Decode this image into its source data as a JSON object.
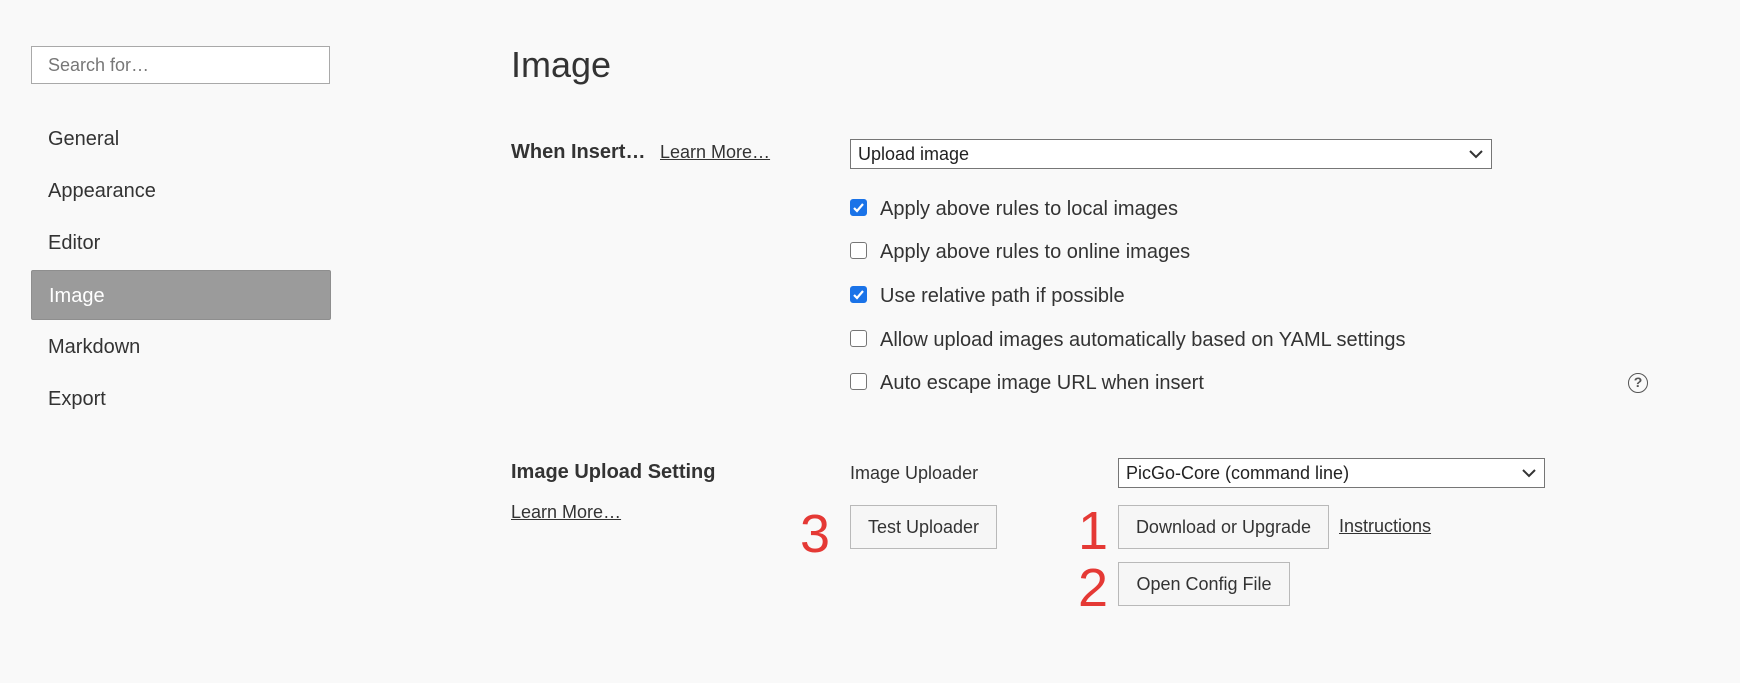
{
  "sidebar": {
    "search_placeholder": "Search for…",
    "items": [
      {
        "label": "General"
      },
      {
        "label": "Appearance"
      },
      {
        "label": "Editor"
      },
      {
        "label": "Image",
        "active": true
      },
      {
        "label": "Markdown"
      },
      {
        "label": "Export"
      }
    ]
  },
  "main": {
    "title": "Image",
    "when_insert": {
      "label": "When Insert…",
      "learn_more": "Learn More…",
      "selected": "Upload image",
      "options": [
        {
          "label": "Apply above rules to local images",
          "checked": true
        },
        {
          "label": "Apply above rules to online images",
          "checked": false
        },
        {
          "label": "Use relative path if possible",
          "checked": true
        },
        {
          "label": "Allow upload images automatically based on YAML settings",
          "checked": false
        },
        {
          "label": "Auto escape image URL when insert",
          "checked": false
        }
      ],
      "help_icon": "?"
    },
    "upload_setting": {
      "label": "Image Upload Setting",
      "learn_more": "Learn More…",
      "uploader_label": "Image Uploader",
      "uploader_selected": "PicGo-Core (command line)",
      "test_button": "Test Uploader",
      "download_button": "Download or Upgrade",
      "instructions_link": "Instructions",
      "open_config_button": "Open Config File"
    },
    "annotations": {
      "one": "1",
      "two": "2",
      "three": "3"
    },
    "colors": {
      "accent": "#1a73e8",
      "active_nav": "#9b9b9b",
      "annotation": "#e53935"
    }
  }
}
